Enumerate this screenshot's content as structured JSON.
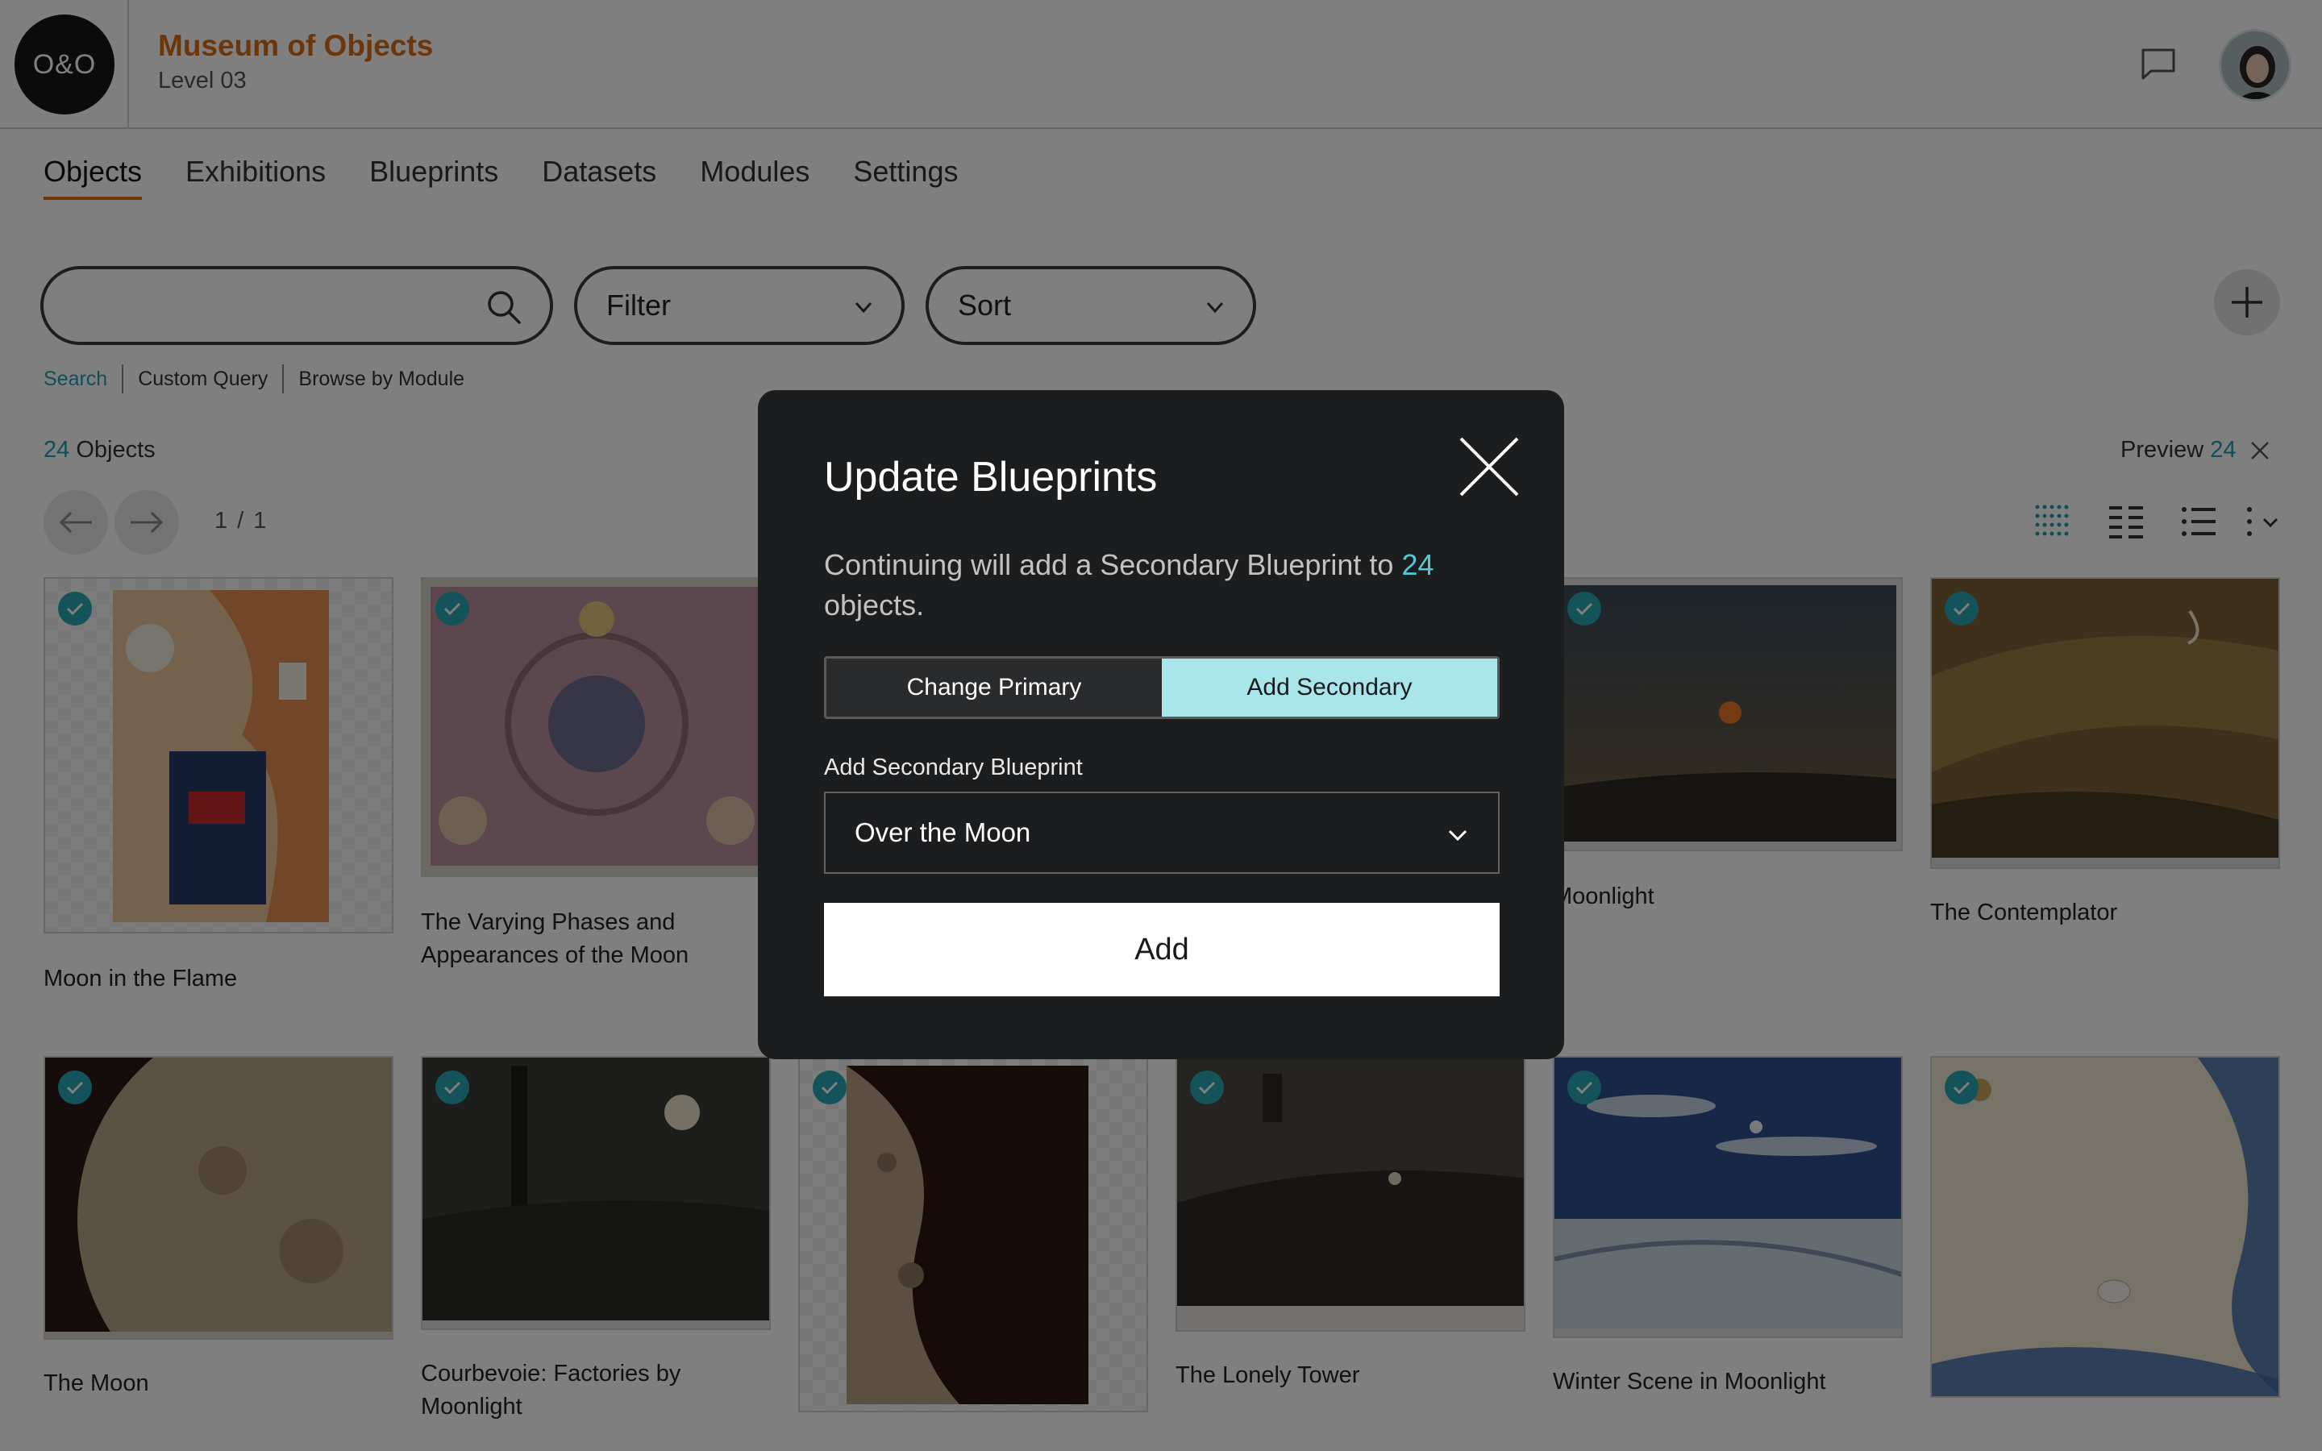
{
  "header": {
    "logo_text": "O&O",
    "museum_title": "Museum of Objects",
    "level": "Level 03"
  },
  "tabs": [
    {
      "label": "Objects",
      "active": true
    },
    {
      "label": "Exhibitions"
    },
    {
      "label": "Blueprints"
    },
    {
      "label": "Datasets"
    },
    {
      "label": "Modules"
    },
    {
      "label": "Settings"
    }
  ],
  "toolbar": {
    "search_placeholder": "",
    "filter_label": "Filter",
    "sort_label": "Sort"
  },
  "search_modes": [
    "Search",
    "Custom Query",
    "Browse by Module"
  ],
  "results": {
    "count": "24",
    "count_label": " Objects",
    "pager": "1 / 1",
    "preview_label": "Preview ",
    "preview_count": "24"
  },
  "objects": [
    {
      "title": "Moon in the Flame"
    },
    {
      "title": "The Varying Phases and Appearances of the Moon"
    },
    {
      "title": "Moonlight"
    },
    {
      "title": "The Contemplator"
    },
    {
      "title": "The Moon"
    },
    {
      "title": "Courbevoie: Factories by Moonlight"
    },
    {
      "title": "The Lonely Tower"
    },
    {
      "title": "Winter Scene in Moonlight"
    }
  ],
  "modal": {
    "title": "Update Blueprints",
    "message_prefix": "Continuing will add a Secondary Blueprint to ",
    "message_count": "24",
    "message_suffix": " objects.",
    "segment_primary": "Change Primary",
    "segment_secondary": "Add Secondary",
    "field_label": "Add Secondary Blueprint",
    "selected_blueprint": "Over the Moon",
    "add_label": "Add"
  },
  "colors": {
    "accent_orange": "#d96d17",
    "accent_teal": "#2aa7b5",
    "segment_active": "#a9e6ec"
  }
}
